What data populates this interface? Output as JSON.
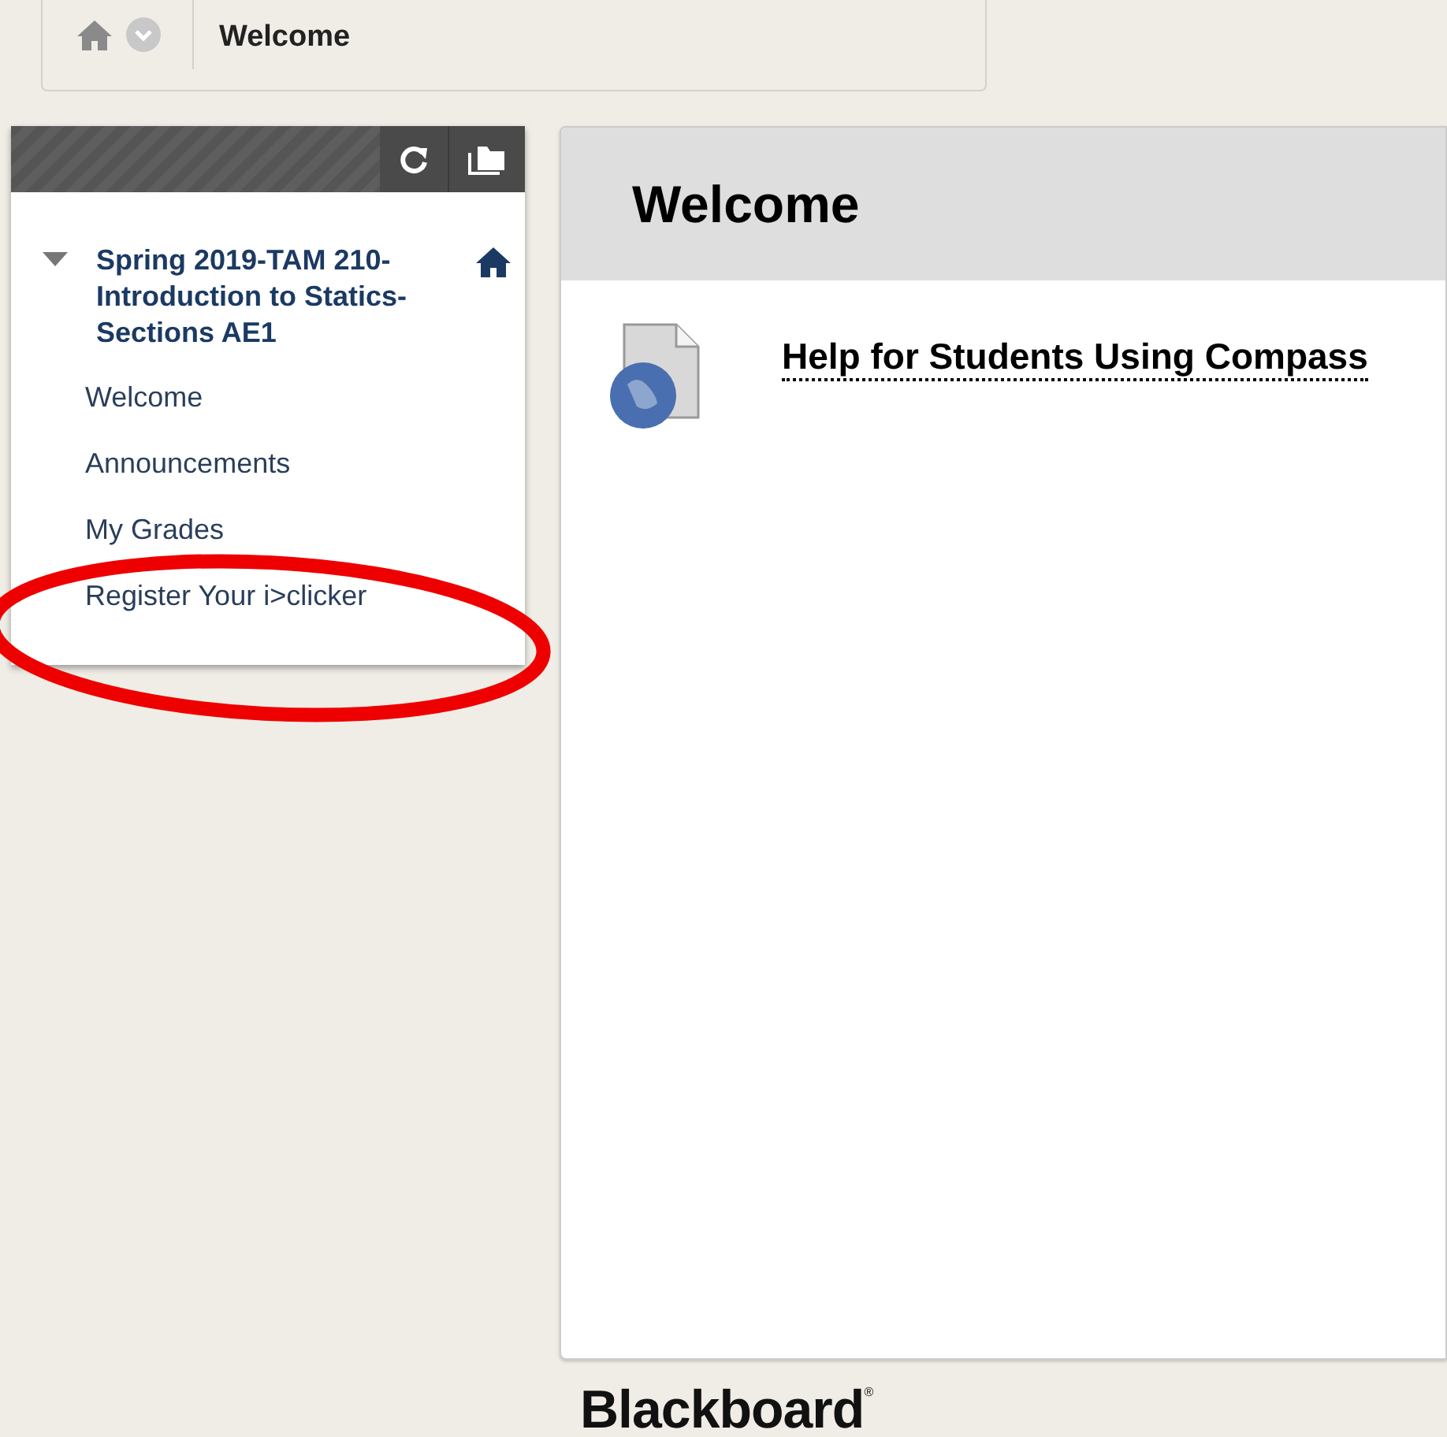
{
  "breadcrumb": {
    "current": "Welcome"
  },
  "course_menu": {
    "course_title": "Spring 2019-TAM 210-Introduction to Statics-Sections AE1",
    "expanded": true,
    "items": [
      {
        "label": "Welcome"
      },
      {
        "label": "Announcements"
      },
      {
        "label": "My Grades"
      },
      {
        "label": "Register Your i>clicker"
      }
    ]
  },
  "content": {
    "title": "Welcome",
    "items": [
      {
        "label": "Help for Students Using Compass"
      }
    ]
  },
  "footer": {
    "logo": "Blackboard",
    "mark": "®"
  }
}
